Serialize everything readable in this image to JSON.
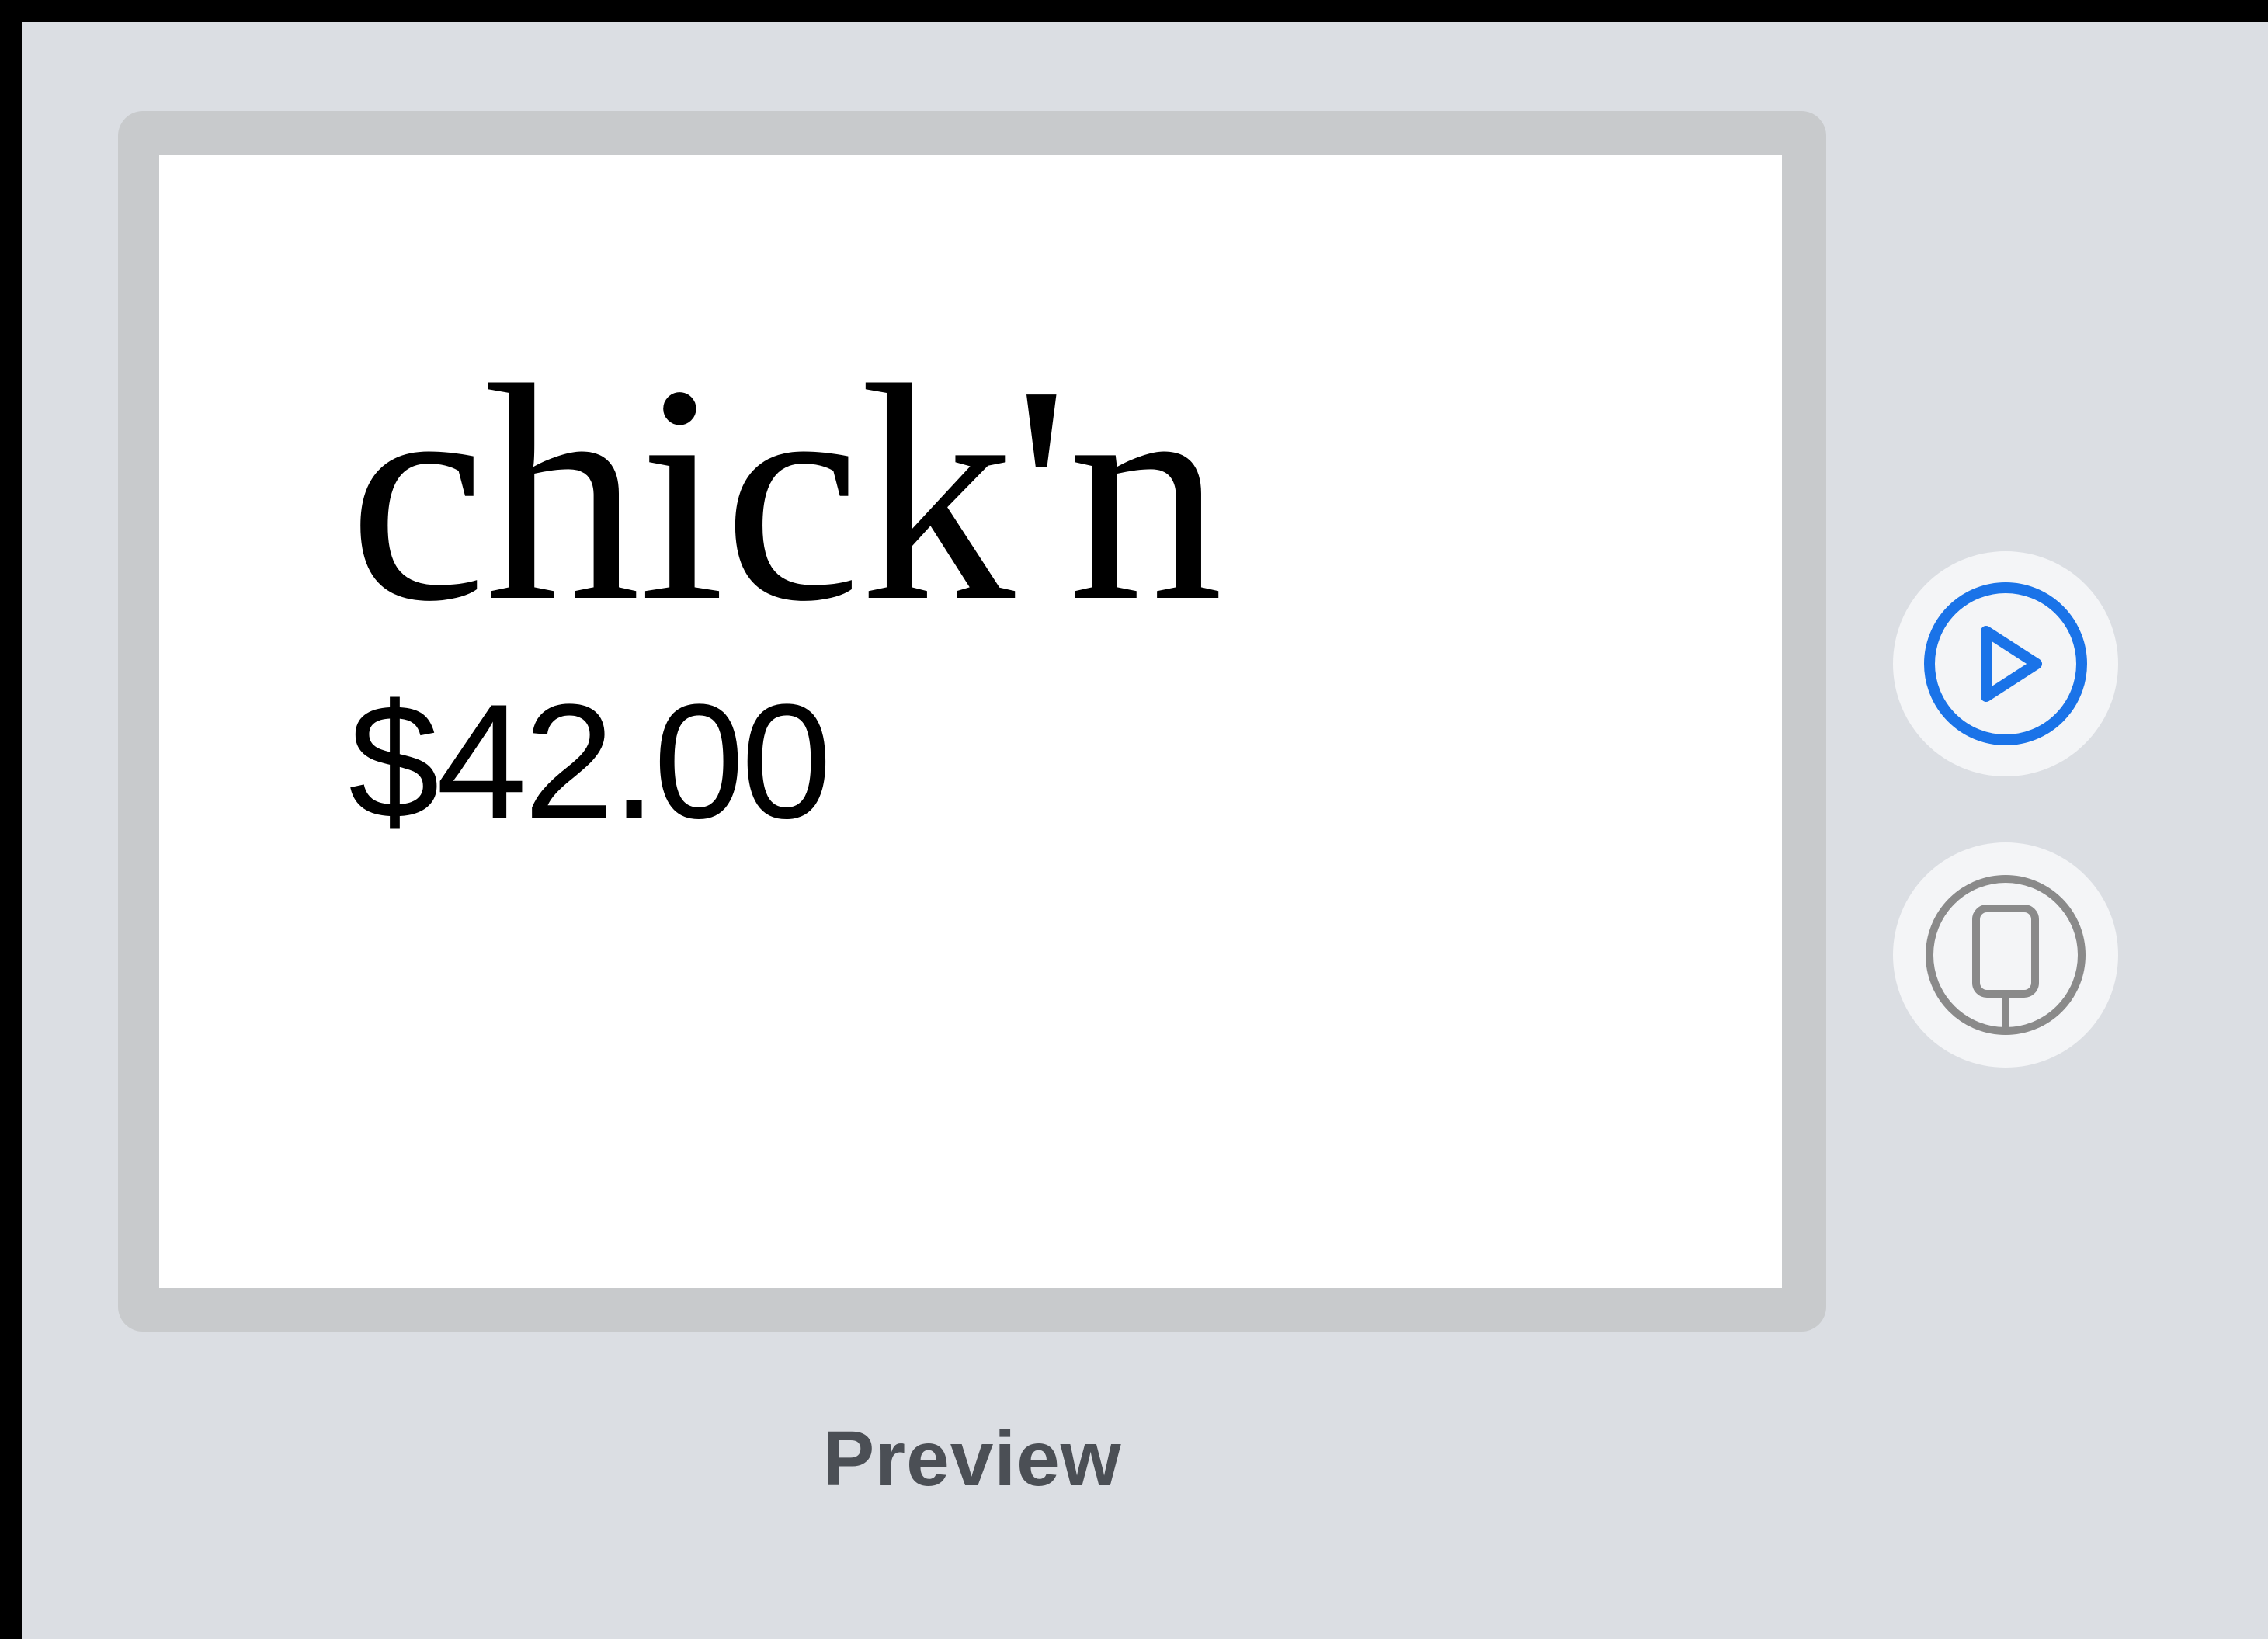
{
  "preview": {
    "product_name": "chick'n",
    "product_price": "$42.00",
    "caption": "Preview"
  },
  "controls": {
    "play": {
      "icon": "play-circle-icon",
      "color": "#1a73e8"
    },
    "device": {
      "icon": "device-icon",
      "color": "#8a8a8a"
    }
  },
  "colors": {
    "background": "#dbdee3",
    "frame": "#c8cacc",
    "accent": "#1a73e8"
  }
}
